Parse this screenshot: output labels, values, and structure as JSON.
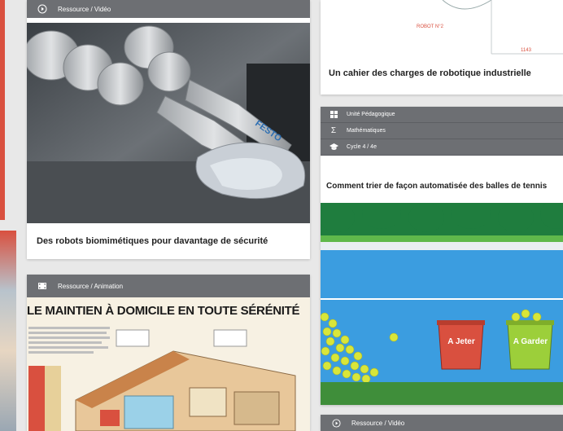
{
  "left_edge": {
    "accent_color": "#d9503f"
  },
  "card_robot_video": {
    "header_label": "Ressource / Vidéo",
    "title": "Des robots biomimétiques pour davantage de sécurité",
    "image_brand_text": "FESTO"
  },
  "card_animation": {
    "header_label": "Ressource / Animation",
    "image_title": "LE MAINTIEN À DOMICILE EN TOUTE SÉRÉNITÉ"
  },
  "card_cahier": {
    "diagram_label_1": "ROBOT N°2",
    "diagram_label_2": "1143",
    "title": "Un cahier des charges de robotique industrielle"
  },
  "card_tennis": {
    "meta": [
      {
        "icon": "grid-icon",
        "label": "Unité Pédagogique"
      },
      {
        "icon": "sigma-icon",
        "label": "Mathématiques"
      },
      {
        "icon": "graduation-cap-icon",
        "label": "Cycle 4 / 4e"
      }
    ],
    "title": "Comment trier de façon automatisée des balles de tennis",
    "bin_red_label": "A Jeter",
    "bin_green_label": "A Garder"
  },
  "card_bottom_video": {
    "header_label": "Ressource / Vidéo"
  }
}
